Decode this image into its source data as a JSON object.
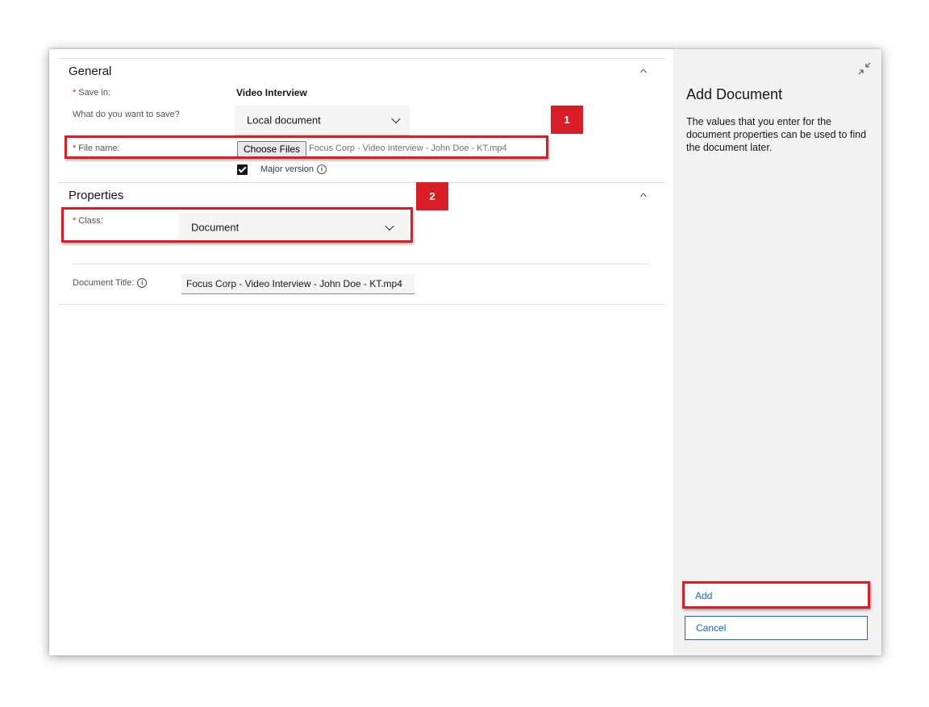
{
  "general": {
    "title": "General",
    "save_in_label": "Save in:",
    "save_in_value": "Video Interview",
    "what_label": "What do you want to save?",
    "what_value": "Local document",
    "file_name_label": "File name:",
    "choose_files_label": "Choose Files",
    "file_name_value": "Focus Corp - Video Interview - John Doe - KT.mp4",
    "major_version_label": "Major version",
    "major_version_checked": true,
    "required_mark": "*"
  },
  "properties": {
    "title": "Properties",
    "class_label": "Class:",
    "class_value": "Document",
    "document_title_label": "Document Title:",
    "document_title_value": "Focus Corp - Video Interview - John Doe - KT.mp4"
  },
  "callouts": {
    "one": "1",
    "two": "2"
  },
  "sidebar": {
    "title": "Add Document",
    "description": "The values that you enter for the document properties can be used to find the document later.",
    "add_label": "Add",
    "cancel_label": "Cancel"
  },
  "icons": {
    "collapse": "chevron-up-icon",
    "minimize": "minimize-arrows-icon",
    "info": "info-icon",
    "dropdown": "chevron-down-icon",
    "info_glyph": "i"
  },
  "colors": {
    "accent": "#0f62fe",
    "required": "#da1e28",
    "highlight": "#da1e28",
    "sidebar_bg": "#f2f2f2"
  }
}
